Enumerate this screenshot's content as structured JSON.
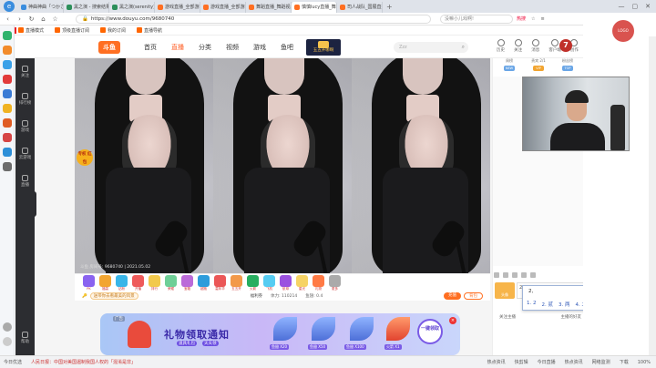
{
  "browser": {
    "tabs": [
      {
        "label": "神曲神曲「つかさ・",
        "fav": "#3a8dde"
      },
      {
        "label": "黑之演 - 搜索结果 - 来站…",
        "fav": "#2c8f5a"
      },
      {
        "label": "黑之演(serenity)的个人空…",
        "fav": "#2c8f5a"
      },
      {
        "label": "游戏直播_全部游戏直播",
        "fav": "#ff6f22"
      },
      {
        "label": "游戏直播_全部游戏直播",
        "fav": "#ff6f22"
      },
      {
        "label": "舞蹈直播_舞蹈视频_斗鱼…",
        "fav": "#ff6f22"
      },
      {
        "label": "慎慎lucy直播_舞蹈直播",
        "fav": "#ff6f22",
        "active": true
      },
      {
        "label": "司人战队_国展直播",
        "fav": "#ff6f22"
      }
    ],
    "new_tab": "+",
    "url": "https://www.douyu.com/9680740",
    "search_placeholder": "没嘛小儿戏啊!",
    "addr_extra": [
      "热搜",
      "☆",
      "≡"
    ],
    "bookmarks_logo": "360",
    "bookmarks": [
      "直播模式",
      "顶级直播订阅",
      "我的订阅",
      "直播导航"
    ]
  },
  "site": {
    "logo": "斗鱼",
    "nav": [
      "首页",
      "直播",
      "分类",
      "视频",
      "游戏",
      "鱼吧"
    ],
    "nav_active": 1,
    "promo": "五五开哪啊",
    "search_placeholder": "Zzz",
    "header_right": [
      "历史",
      "关注",
      "消息",
      "客户端",
      "创作"
    ],
    "user_avatar": "7"
  },
  "rail": {
    "items": [
      "关注",
      "排行榜",
      "游戏",
      "云游戏",
      "直播",
      "客服"
    ],
    "bottom": "帮助"
  },
  "player": {
    "badge": "专权 红包",
    "watermark": "斗鱼 房间号: 9680740 | 2021.05.02"
  },
  "gift_bar": {
    "gift_labels": [
      "PK",
      "福袋",
      "钻粉",
      "开播",
      "排行",
      "荣耀",
      "宝箱",
      "超跑",
      "嘉年华",
      "五五开",
      "火箭",
      "飞机",
      "航母",
      "星光",
      "礼物",
      "更多"
    ],
    "announcement": "送带你去看最美的风景",
    "item_label": "福利券",
    "stats": [
      "体力: 110214",
      "鱼翅: 0.4"
    ],
    "btn_recharge": "充值",
    "btn_backpack": "背包"
  },
  "ad": {
    "tag": "广告",
    "title": "礼物领取通知",
    "sub": [
      "道具礼包",
      "天天领"
    ],
    "items": [
      "鱼翅 X20",
      "鱼翅 X50",
      "鱼翅 X100",
      "火箭 X1"
    ],
    "cta": "一键领取",
    "close": "×"
  },
  "right": {
    "rank": [
      "周榜",
      "贵宾 2/1",
      "粉丝榜"
    ],
    "rank_badges": [
      "NEW",
      "VIP",
      "TOP"
    ],
    "chat_tools_label": "屏蔽特效",
    "chat_avatar": "头像",
    "chat_input": "2",
    "send": "发送",
    "ime_typed": "2,",
    "ime_candidates": [
      "1. 2",
      "2. 贰",
      "3. 两",
      "4. 二",
      "5. 两"
    ],
    "follow_left": "关注主播",
    "follow_right": "主播的好友"
  },
  "far_right": {
    "avatar": "LOGO"
  },
  "statusbar": {
    "left": "今日优选",
    "news": "人民日报：中国对美国遏制我国人权的「混淆是非」",
    "items": [
      "热点资讯",
      "快剪辑",
      "今日直播",
      "热点资讯",
      "网络监测",
      "下载",
      "100%"
    ]
  }
}
